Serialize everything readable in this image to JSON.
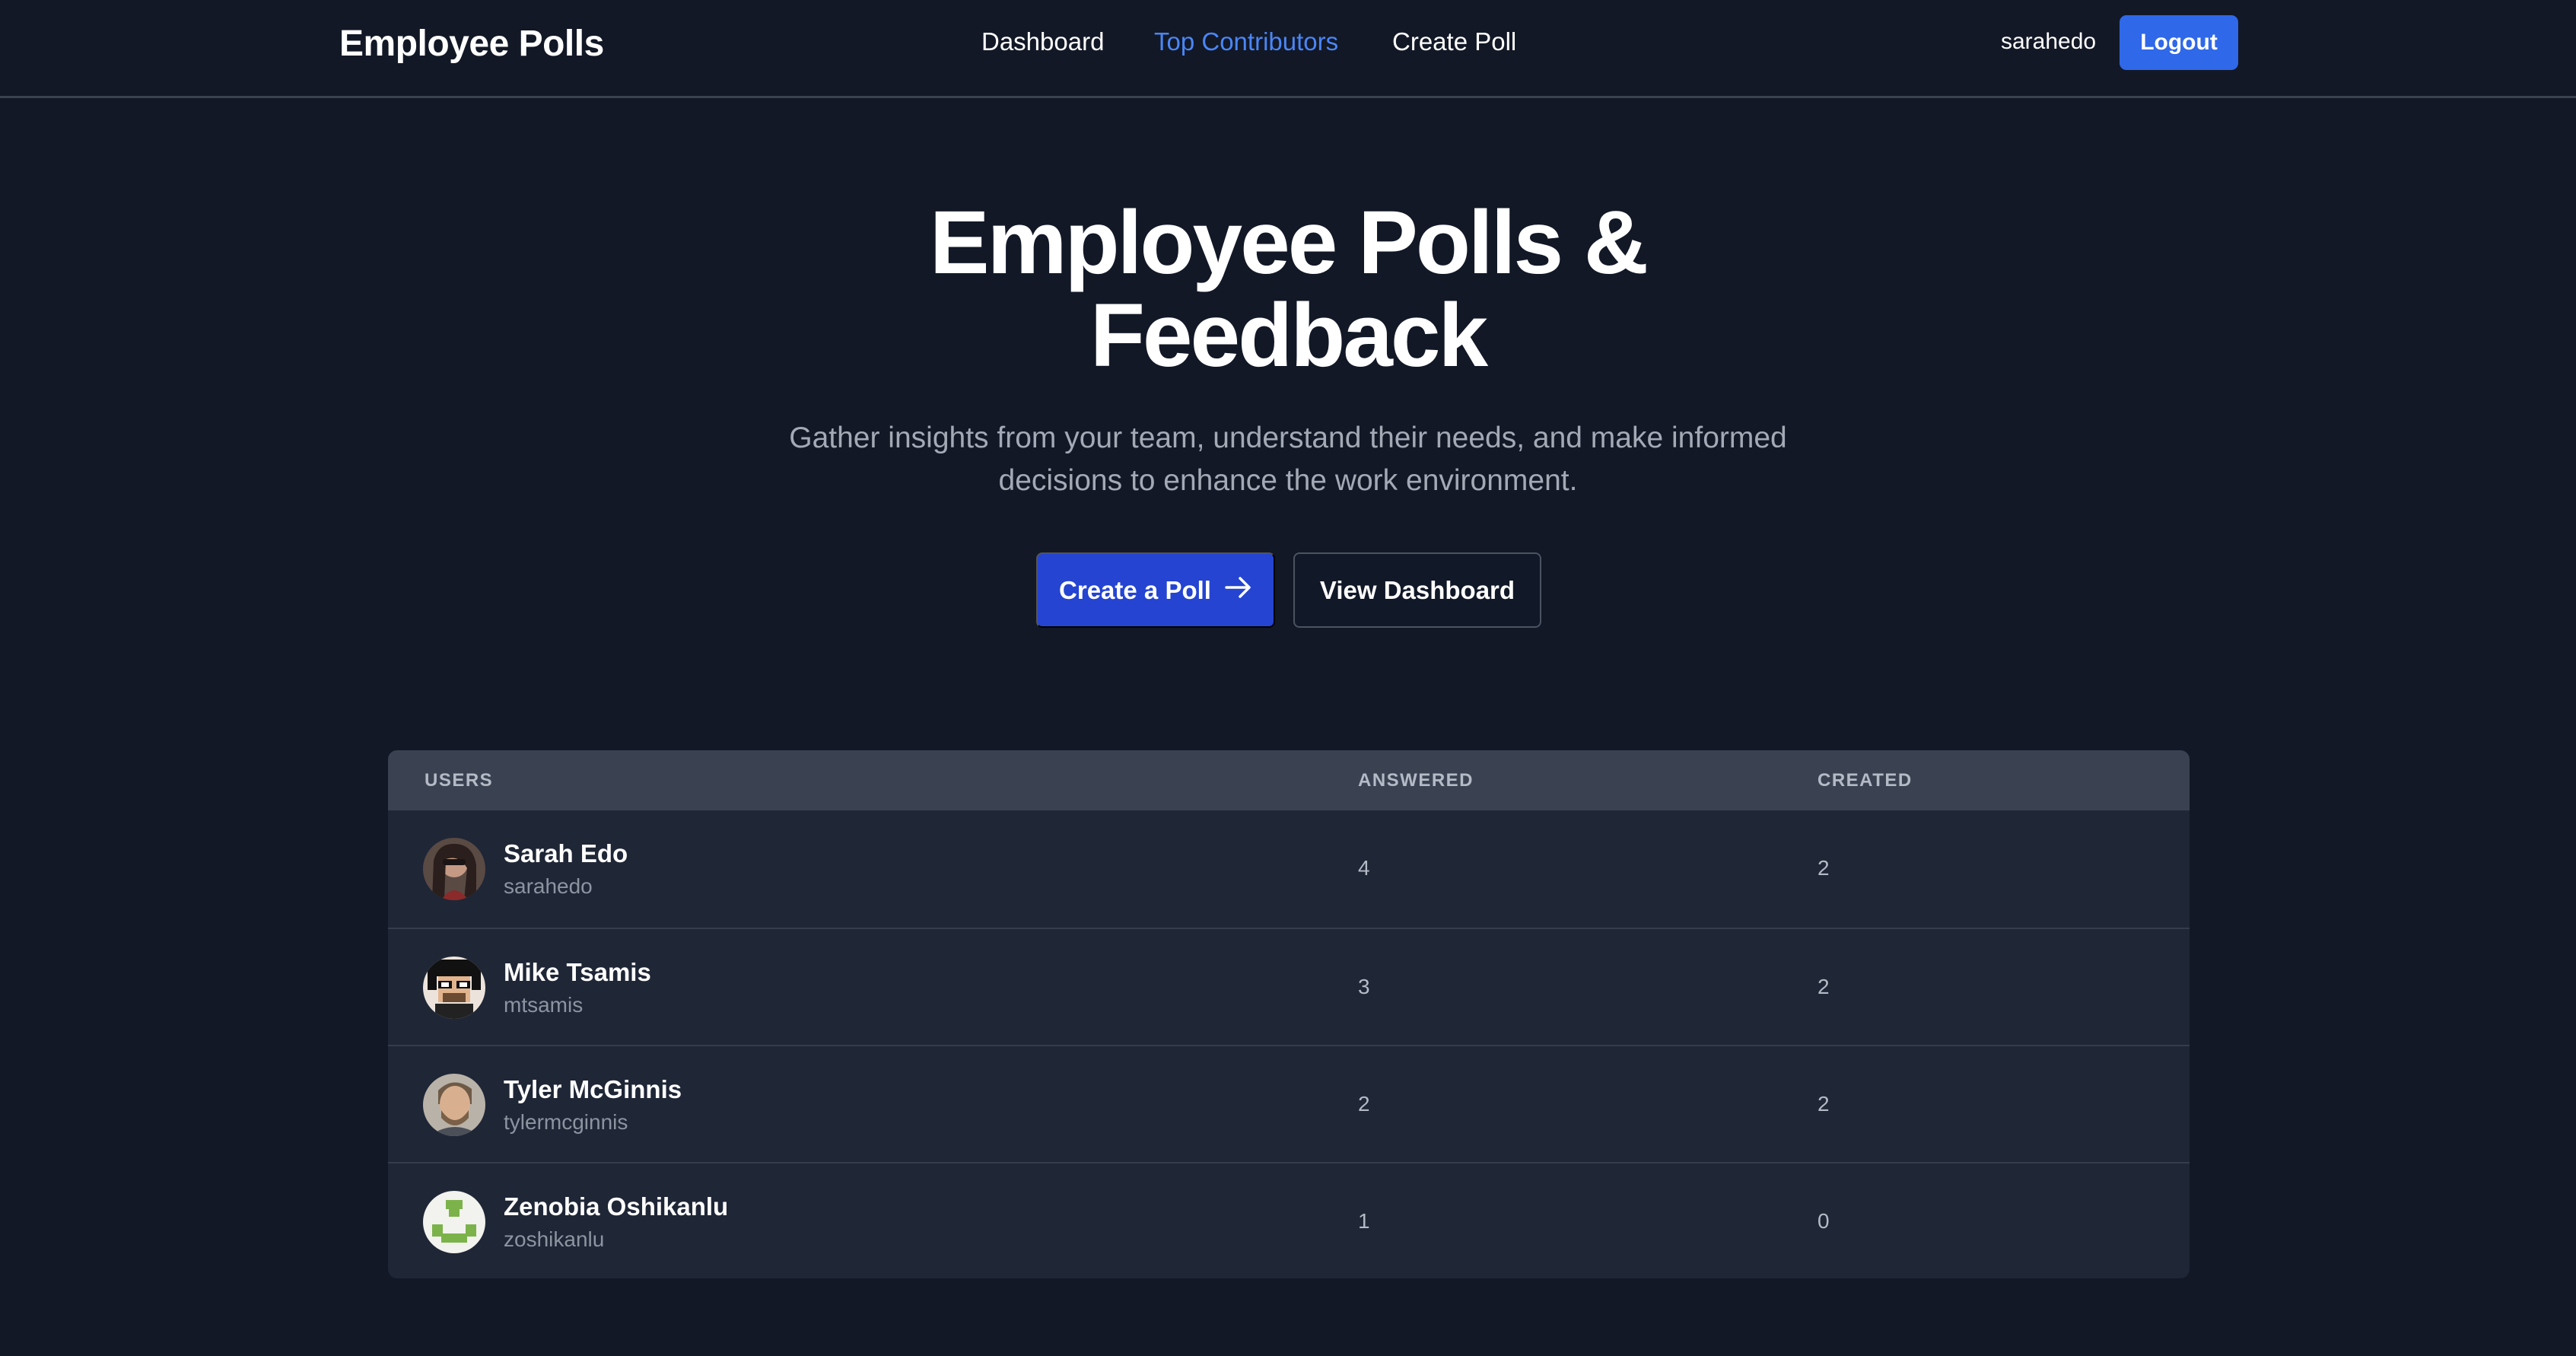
{
  "nav": {
    "brand": "Employee Polls",
    "links": [
      {
        "label": "Dashboard",
        "active": false
      },
      {
        "label": "Top Contributors",
        "active": true
      },
      {
        "label": "Create Poll",
        "active": false
      }
    ],
    "username": "sarahedo",
    "logout_label": "Logout"
  },
  "hero": {
    "title_line1": "Employee Polls &",
    "title_line2": "Feedback",
    "subtitle": "Gather insights from your team, understand their needs, and make informed decisions to enhance the work environment.",
    "primary_button": "Create a Poll",
    "primary_button_icon": "arrow-right-icon",
    "secondary_button": "View Dashboard"
  },
  "table": {
    "columns": [
      "USERS",
      "ANSWERED",
      "CREATED"
    ],
    "rows": [
      {
        "name": "Sarah Edo",
        "handle": "sarahedo",
        "answered": "4",
        "created": "2",
        "avatar": "photo-avatar"
      },
      {
        "name": "Mike Tsamis",
        "handle": "mtsamis",
        "answered": "3",
        "created": "2",
        "avatar": "pixel-avatar"
      },
      {
        "name": "Tyler McGinnis",
        "handle": "tylermcginnis",
        "answered": "2",
        "created": "2",
        "avatar": "photo-avatar"
      },
      {
        "name": "Zenobia Oshikanlu",
        "handle": "zoshikanlu",
        "answered": "1",
        "created": "0",
        "avatar": "identicon-avatar"
      }
    ]
  },
  "colors": {
    "background": "#121826",
    "accent": "#2f68e8",
    "active_link": "#4a86f5",
    "table_bg": "#1f2636",
    "table_head_bg": "#3a4252"
  }
}
